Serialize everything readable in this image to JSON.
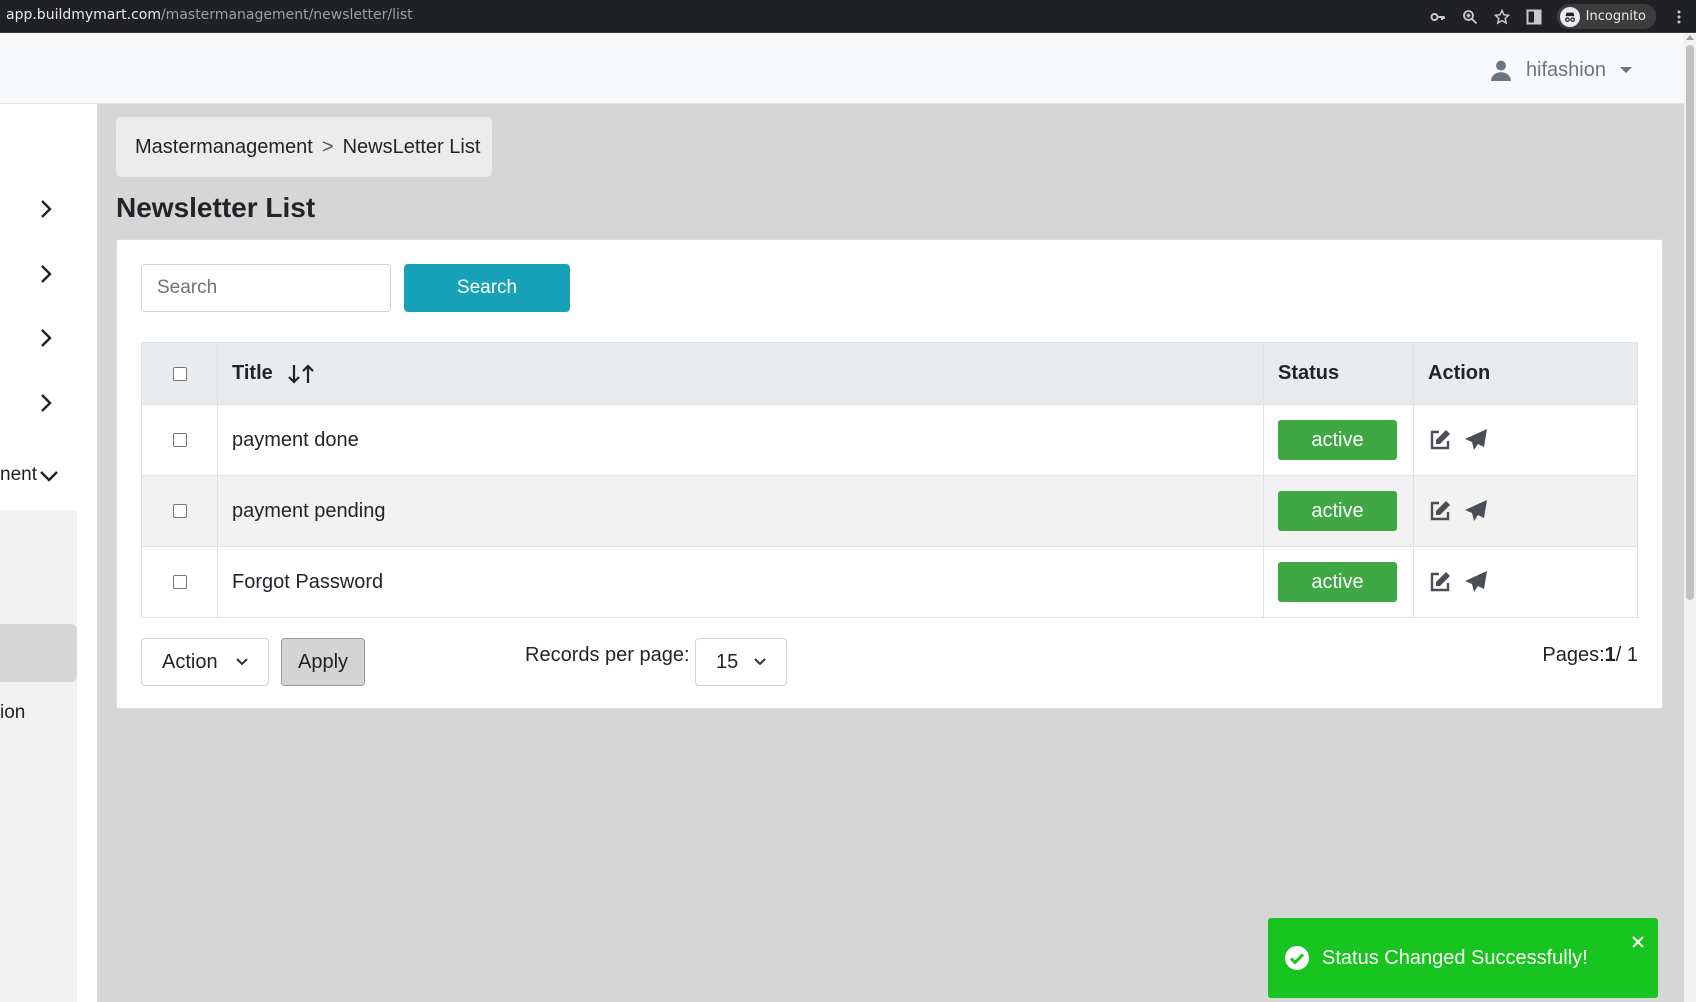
{
  "browser": {
    "url_host": "app.buildmymart.com",
    "url_path": "/mastermanagement/newsletter/list",
    "incognito_label": "Incognito"
  },
  "header": {
    "username": "hifashion"
  },
  "sidebar": {
    "partial_label_1": "nent",
    "partial_label_2": "ion"
  },
  "breadcrumb": {
    "parent": "Mastermanagement",
    "separator": ">",
    "current": "NewsLetter List"
  },
  "page_title": "Newsletter List",
  "search": {
    "placeholder": "Search",
    "button_label": "Search"
  },
  "table": {
    "headers": {
      "title": "Title",
      "status": "Status",
      "action": "Action"
    },
    "rows": [
      {
        "title": "payment done",
        "status": "active"
      },
      {
        "title": "payment pending",
        "status": "active"
      },
      {
        "title": "Forgot Password",
        "status": "active"
      }
    ]
  },
  "footer": {
    "bulk_action_label": "Action",
    "apply_label": "Apply",
    "records_per_page_label": "Records per page:",
    "records_per_page_value": "15",
    "pages_label": "Pages:",
    "current_page": "1",
    "total_pages": "/ 1"
  },
  "toast": {
    "message": "Status Changed Successfully!"
  },
  "colors": {
    "primary_button": "#17a2b8",
    "status_active": "#3fa845",
    "toast_success": "#18c41f"
  }
}
